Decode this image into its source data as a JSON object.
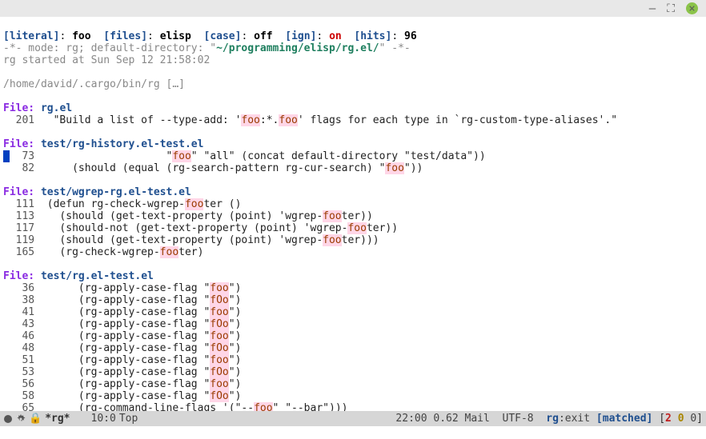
{
  "titlebar": {
    "min": "—",
    "max": "⛶",
    "close": "×"
  },
  "header": {
    "literal_key": "[literal]",
    "literal_val": "foo",
    "files_key": "[files]",
    "files_val": "elisp",
    "case_key": "[case]",
    "case_val": "off",
    "ign_key": "[ign]",
    "ign_val": "on",
    "hits_key": "[hits]",
    "hits_val": "96"
  },
  "meta": {
    "line_pre": "-*- mode: rg; default-directory: \"",
    "dir": "~/programming/elisp/rg.el/",
    "line_post": "\" -*-",
    "started": "rg started at Sun Sep 12 21:58:02",
    "cmd": "/home/david/.cargo/bin/rg […]"
  },
  "files": [
    {
      "name": "rg.el",
      "lines": [
        {
          "n": "201",
          "pre": "  \"Build a list of --type-add: '",
          "m1": "foo",
          "mid": ":*.",
          "m2": "foo",
          "post": "' flags for each type in `rg-custom-type-aliases'.\""
        }
      ]
    },
    {
      "name": "test/rg-history.el-test.el",
      "lines": [
        {
          "n": "73",
          "cursor": true,
          "pre": "                    \"",
          "m1": "foo",
          "post": "\" \"all\" (concat default-directory \"test/data\"))"
        },
        {
          "n": "82",
          "pre": "     (should (equal (rg-search-pattern rg-cur-search) \"",
          "m1": "foo",
          "post": "\"))"
        }
      ]
    },
    {
      "name": "test/wgrep-rg.el-test.el",
      "lines": [
        {
          "n": "111",
          "pre": " (defun rg-check-wgrep-",
          "m1": "foo",
          "post": "ter ()"
        },
        {
          "n": "113",
          "pre": "   (should (get-text-property (point) 'wgrep-",
          "m1": "foo",
          "post": "ter))"
        },
        {
          "n": "117",
          "pre": "   (should-not (get-text-property (point) 'wgrep-",
          "m1": "foo",
          "post": "ter))"
        },
        {
          "n": "119",
          "pre": "   (should (get-text-property (point) 'wgrep-",
          "m1": "foo",
          "post": "ter)))"
        },
        {
          "n": "165",
          "pre": "   (rg-check-wgrep-",
          "m1": "foo",
          "post": "ter)"
        }
      ]
    },
    {
      "name": "test/rg.el-test.el",
      "lines": [
        {
          "n": "36",
          "pre": "      (rg-apply-case-flag \"",
          "m1": "foo",
          "post": "\")"
        },
        {
          "n": "38",
          "pre": "      (rg-apply-case-flag \"",
          "m1": "fOo",
          "post": "\")"
        },
        {
          "n": "41",
          "pre": "      (rg-apply-case-flag \"",
          "m1": "foo",
          "post": "\")"
        },
        {
          "n": "43",
          "pre": "      (rg-apply-case-flag \"",
          "m1": "fOo",
          "post": "\")"
        },
        {
          "n": "46",
          "pre": "      (rg-apply-case-flag \"",
          "m1": "foo",
          "post": "\")"
        },
        {
          "n": "48",
          "pre": "      (rg-apply-case-flag \"",
          "m1": "fOo",
          "post": "\")"
        },
        {
          "n": "51",
          "pre": "      (rg-apply-case-flag \"",
          "m1": "foo",
          "post": "\")"
        },
        {
          "n": "53",
          "pre": "      (rg-apply-case-flag \"",
          "m1": "fOo",
          "post": "\")"
        },
        {
          "n": "56",
          "pre": "      (rg-apply-case-flag \"",
          "m1": "foo",
          "post": "\")"
        },
        {
          "n": "58",
          "pre": "      (rg-apply-case-flag \"",
          "m1": "fOo",
          "post": "\")"
        },
        {
          "n": "65",
          "pre": "      (rg-command-line-flags '(\"--",
          "m1": "foo",
          "post": "\" \"--bar\")))"
        }
      ]
    }
  ],
  "modeline": {
    "buffer": "*rg*",
    "pos": "10:0",
    "scroll": "Top",
    "time": "22:00",
    "load": "0.62",
    "mail": "Mail",
    "enc": "UTF-8",
    "mode": "rg ",
    "exit": ":exit",
    "status": "[matched]",
    "counts": {
      "open": "[",
      "a": "2",
      "b": "0",
      "c": "0",
      "close": "]"
    }
  }
}
